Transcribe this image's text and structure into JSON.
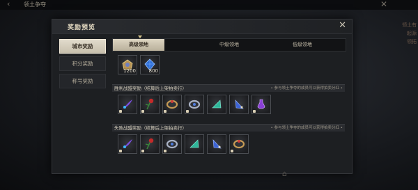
{
  "background": {
    "title": "领土争夺",
    "back_glyph": "‹",
    "close_glyph": "✕",
    "side_texts": [
      "领土有",
      "起源",
      "领拓"
    ]
  },
  "modal": {
    "title": "奖励预览",
    "close_glyph": "✕"
  },
  "sidebar": {
    "items": [
      {
        "label": "城市奖励",
        "active": true
      },
      {
        "label": "积分奖励",
        "active": false
      },
      {
        "label": "称号奖励",
        "active": false
      }
    ]
  },
  "tabs": [
    {
      "label": "高级领地",
      "active": true
    },
    {
      "label": "中级领地",
      "active": false
    },
    {
      "label": "低级领地",
      "active": false
    }
  ],
  "top_rewards": [
    {
      "icon": "gold-chest-icon",
      "qty": "1200"
    },
    {
      "icon": "blue-diamond-icon",
      "qty": "800"
    }
  ],
  "victory_section": {
    "title": "胜利战盟奖励（结算后上架拍卖行）",
    "note": "• 参与领土争夺的成员可以获得拍卖分红 •",
    "items": [
      "purple-feather-icon",
      "red-rose-icon",
      "bronze-ring-icon",
      "silver-amulet-icon",
      "teal-gem-icon",
      "blue-crystal-icon",
      "violet-potion-icon"
    ]
  },
  "defeat_section": {
    "title": "失败战盟奖励（结算后上架拍卖行）",
    "note": "• 参与领土争夺的成员可以获得拍卖分红 •",
    "items": [
      "purple-feather-icon",
      "red-rose-icon",
      "silver-amulet-icon",
      "teal-gem-icon",
      "blue-crystal-icon",
      "bronze-ring-icon"
    ]
  },
  "colors": {
    "accent_gold": "#d8c68f",
    "panel_bg": "#1d1f22"
  }
}
